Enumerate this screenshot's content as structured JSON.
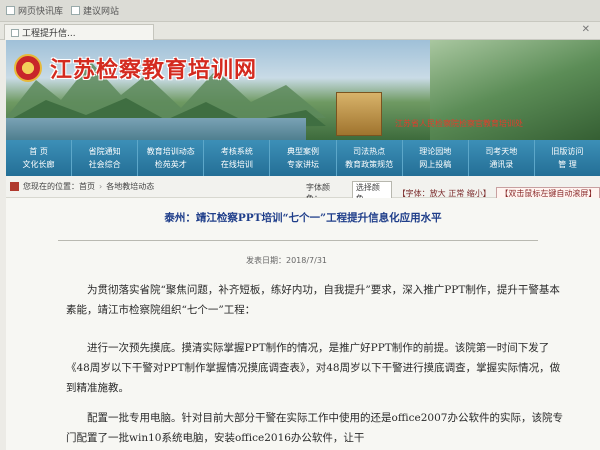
{
  "browser": {
    "favorites_label": "网页快讯库",
    "suggested_label": "建议网站",
    "tab_title": "工程提升信...",
    "close_glyph": "✕"
  },
  "banner": {
    "site_title": "江苏检察教育培训网",
    "slogan": "江苏省人民检察院检察官教育培训处"
  },
  "nav": [
    {
      "top": "首  页",
      "bottom": "文化长廊"
    },
    {
      "top": "省院通知",
      "bottom": "社会综合"
    },
    {
      "top": "教育培训动态",
      "bottom": "检苑英才"
    },
    {
      "top": "考核系统",
      "bottom": "在线培训"
    },
    {
      "top": "典型案例",
      "bottom": "专家讲坛"
    },
    {
      "top": "司法热点",
      "bottom": "教育政策规范"
    },
    {
      "top": "理论园地",
      "bottom": "网上投稿"
    },
    {
      "top": "司考天地",
      "bottom": "通讯录"
    },
    {
      "top": "旧版访问",
      "bottom": "管  理"
    }
  ],
  "breadcrumb": {
    "prefix": "您现在的位置：",
    "home": "首页",
    "section": "各地教培动态"
  },
  "tools": {
    "font_color_label": "字体颜色：",
    "font_color_value": "选择颜色",
    "font_size": "【字体：放大 正常 缩小】",
    "revert": "【双击鼠标左键自动滚屏】"
  },
  "article": {
    "title": "泰州：靖江检察PPT培训“七个一”工程提升信息化应用水平",
    "date": "发表日期：2018/7/31",
    "paragraphs": [
      "为贯彻落实省院“聚焦问题，补齐短板，练好内功，自我提升”要求，深入推广PPT制作，提升干警基本素能，靖江市检察院组织“七个一”工程：",
      "进行一次预先摸底。摸清实际掌握PPT制作的情况，是推广好PPT制作的前提。该院第一时间下发了《48周岁以下干警对PPT制作掌握情况摸底调查表》，对48周岁以下干警进行摸底调查，掌握实际情况，做到精准施教。",
      "配置一批专用电脑。针对目前大部分干警在实际工作中使用的还是office2007办公软件的实际，该院专门配置了一批win10系统电脑，安装office2016办公软件，让干"
    ]
  }
}
